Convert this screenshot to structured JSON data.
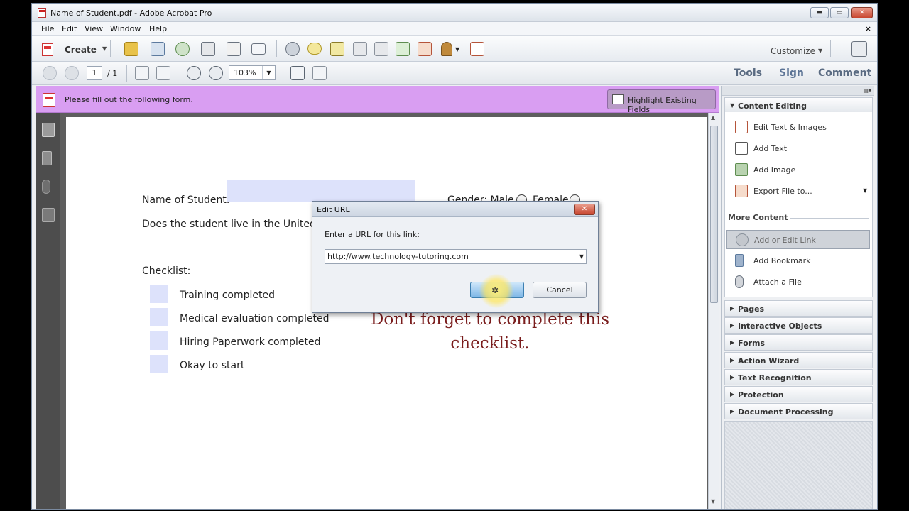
{
  "window": {
    "title": "Name of Student.pdf - Adobe Acrobat Pro",
    "minimize": "▬",
    "restore": "▭",
    "close": "✕"
  },
  "menu": {
    "items": [
      "File",
      "Edit",
      "View",
      "Window",
      "Help"
    ],
    "close_doc": "×"
  },
  "toolbar": {
    "create_label": "Create",
    "create_dropdown": "▼",
    "customize_label": "Customize",
    "customize_dropdown": "▼",
    "page_current": "1",
    "page_total": "/ 1",
    "zoom_value": "103%",
    "zoom_dropdown": "▼",
    "tabs": [
      "Tools",
      "Sign",
      "Comment"
    ]
  },
  "notice": {
    "message": "Please fill out the following form.",
    "highlight_button": "Highlight Existing Fields"
  },
  "form": {
    "name_label": "Name of Student:",
    "gender_label": "Gender: Male",
    "female_label": "Female",
    "residency_question": "Does the student live in the United S",
    "checklist_label": "Checklist:",
    "checklist_items": [
      "Training completed",
      "Medical evaluation completed",
      "Hiring Paperwork completed",
      "Okay to start"
    ],
    "reminder_line1": "Don't forget to complete this",
    "reminder_line2": "checklist."
  },
  "dialog": {
    "title": "Edit URL",
    "close": "✕",
    "prompt": "Enter a URL for this link:",
    "url_value": "http://www.technology-tutoring.com",
    "url_dropdown": "▼",
    "ok_icon": "✲",
    "cancel_label": "Cancel"
  },
  "right_panel": {
    "options_icon": "▤▾",
    "content_editing_header": "Content Editing",
    "expanded_arrow": "▼",
    "collapsed_arrow": "▶",
    "content_editing_items": [
      "Edit Text & Images",
      "Add Text",
      "Add Image",
      "Export File to..."
    ],
    "export_dropdown": "▼",
    "more_content_label": "More Content",
    "more_content_items": [
      "Add or Edit Link",
      "Add Bookmark",
      "Attach a File"
    ],
    "sections": [
      "Pages",
      "Interactive Objects",
      "Forms",
      "Action Wizard",
      "Text Recognition",
      "Protection",
      "Document Processing"
    ]
  },
  "scrollbar": {
    "up": "▲",
    "down": "▼"
  },
  "colors": {
    "notice_bar": "#d99ef2",
    "field_fill": "#dde2fb",
    "reminder_text": "#7a1d1d",
    "ok_button": "#7db6e6",
    "tab_text": "#5a6b82"
  }
}
